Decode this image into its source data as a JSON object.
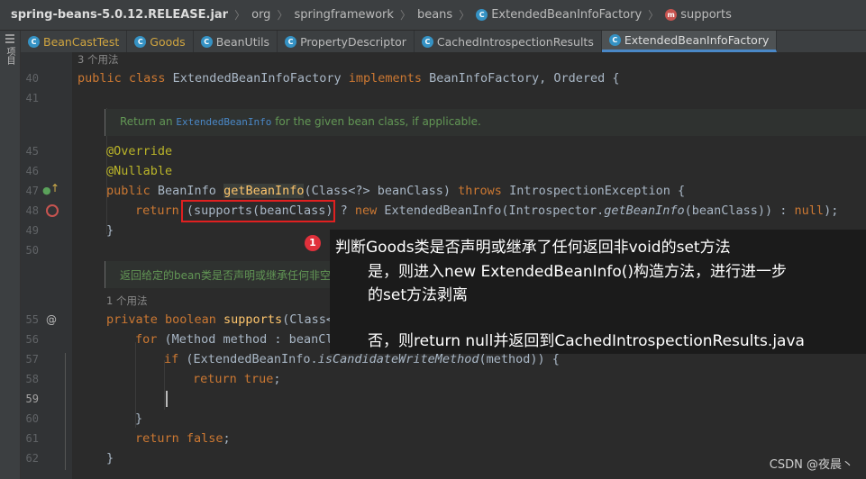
{
  "breadcrumb": {
    "jar": "spring-beans-5.0.12.RELEASE.jar",
    "items": [
      "org",
      "springframework",
      "beans",
      "ExtendedBeanInfoFactory",
      "supports"
    ]
  },
  "sidebar": {
    "project_label": "项目"
  },
  "tabs": [
    "BeanCastTest",
    "Goods",
    "BeanUtils",
    "PropertyDescriptor",
    "CachedIntrospectionResults",
    "ExtendedBeanInfoFactory"
  ],
  "editor": {
    "usages_3": "3 个用法",
    "usages_1": "1 个用法",
    "line_numbers": [
      "40",
      "41",
      "45",
      "46",
      "47",
      "48",
      "49",
      "50",
      "55",
      "56",
      "57",
      "58",
      "59",
      "60",
      "61",
      "62"
    ],
    "doc1_prefix": "Return an ",
    "doc1_link": "ExtendedBeanInfo",
    "doc1_suffix": " for the given bean class, if applicable.",
    "doc2": "返回给定的bean类是否声明或继承任何非空返回bean类型的set方法。",
    "code": {
      "l40_a": "public class ",
      "l40_b": "ExtendedBeanInfoFactory ",
      "l40_c": "implements ",
      "l40_d": "BeanInfoFactory, Ordered {",
      "l45": "@Override",
      "l46": "@Nullable",
      "l47_a": "public ",
      "l47_b": "BeanInfo ",
      "l47_c": "getBeanInfo",
      "l47_d": "(Class<?> beanClass) ",
      "l47_e": "throws ",
      "l47_f": "IntrospectionException {",
      "l48_a": "return ",
      "l48_b": "(supports(beanClass) ",
      "l48_c": "? ",
      "l48_d": "new ",
      "l48_e": "ExtendedBeanInfo(Introspector.",
      "l48_f": "getBeanInfo",
      "l48_g": "(beanClass)) : ",
      "l48_h": "null",
      "l48_i": ");",
      "l49": "}",
      "l55_a": "private boolean ",
      "l55_b": "supports",
      "l55_c": "(Class<?> beanClass) {",
      "l56_a": "for ",
      "l56_b": "(Method method : beanClass.getMethods()) {",
      "l57_a": "if ",
      "l57_b": "(ExtendedBeanInfo.",
      "l57_c": "isCandidateWriteMethod",
      "l57_d": "(method)) {",
      "l58_a": "return ",
      "l58_b": "true",
      "l58_c": ";",
      "l60": "}",
      "l61_a": "return ",
      "l61_b": "false",
      "l61_c": ";",
      "l62": "}"
    }
  },
  "annotation": {
    "badge": "1",
    "line1": "判断Goods类是否声明或继承了任何返回非void的set方法",
    "line2": "是，则进入new ExtendedBeanInfo()构造方法，进行进一步",
    "line3": "的set方法剥离",
    "line4": "否，则return null并返回到CachedIntrospectionResults.java"
  },
  "watermark": "CSDN @夜晨丶"
}
